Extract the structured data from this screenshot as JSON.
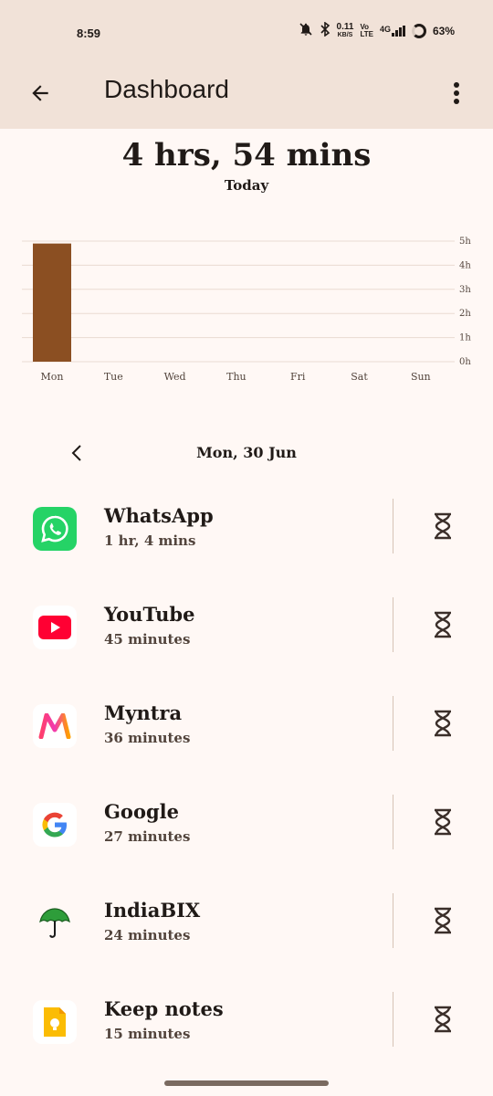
{
  "status_bar": {
    "time": "8:59",
    "net_speed_value": "0.11",
    "net_speed_unit": "KB/S",
    "volte_top": "Vo",
    "volte_bottom": "LTE",
    "network": "4G",
    "battery": "63%"
  },
  "app_bar": {
    "title": "Dashboard",
    "back_icon": "arrow-back-icon",
    "more_icon": "more-vert-icon"
  },
  "summary": {
    "total": "4 hrs, 54 mins",
    "label": "Today"
  },
  "chart_data": {
    "type": "bar",
    "categories": [
      "Mon",
      "Tue",
      "Wed",
      "Thu",
      "Fri",
      "Sat",
      "Sun"
    ],
    "values": [
      4.9,
      0,
      0,
      0,
      0,
      0,
      0
    ],
    "y_ticks": [
      "0h",
      "1h",
      "2h",
      "3h",
      "4h",
      "5h"
    ],
    "ylim": [
      0,
      5
    ],
    "grid": true,
    "bar_color": "#8b4f22"
  },
  "date_nav": {
    "label": "Mon, 30 Jun",
    "prev_icon": "chevron-left-icon"
  },
  "apps": [
    {
      "name": "WhatsApp",
      "usage": "1 hr, 4 mins",
      "icon": "whatsapp-icon"
    },
    {
      "name": "YouTube",
      "usage": "45 minutes",
      "icon": "youtube-icon"
    },
    {
      "name": "Myntra",
      "usage": "36 minutes",
      "icon": "myntra-icon"
    },
    {
      "name": "Google",
      "usage": "27 minutes",
      "icon": "google-icon"
    },
    {
      "name": "IndiaBIX",
      "usage": "24 minutes",
      "icon": "indiabix-icon"
    },
    {
      "name": "Keep notes",
      "usage": "15 minutes",
      "icon": "keep-notes-icon"
    }
  ],
  "colors": {
    "app_bar_bg": "#f1e2d8",
    "page_bg": "#fff8f5",
    "accent": "#8b4f22"
  }
}
